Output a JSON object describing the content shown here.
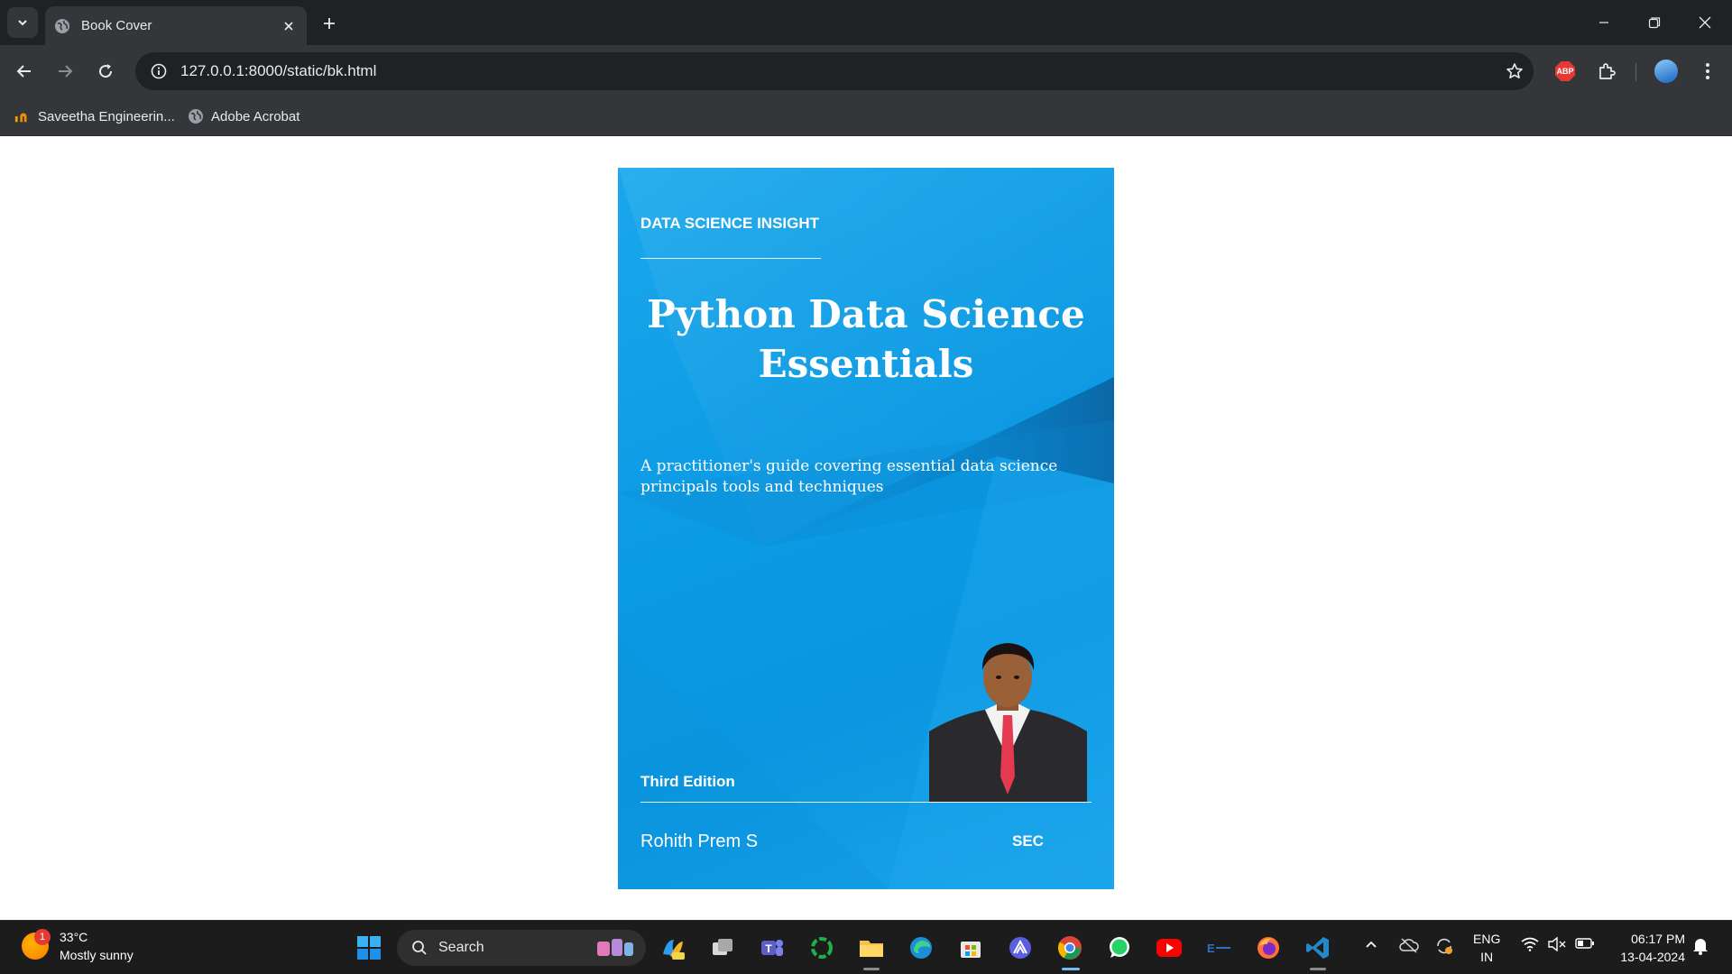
{
  "browser": {
    "tab_title": "Book Cover",
    "url": "127.0.0.1:8000/static/bk.html",
    "bookmarks": [
      {
        "label": "Saveetha Engineerin...",
        "icon": "saveetha-logo-icon"
      },
      {
        "label": "Adobe Acrobat",
        "icon": "globe-icon"
      }
    ],
    "extension_abp_label": "ABP"
  },
  "cover": {
    "series": "DATA SCIENCE INSIGHT",
    "title_line1": "Python Data Science",
    "title_line2": "Essentials",
    "subtitle": "A practitioner's guide covering essential data science principals tools and techniques",
    "edition": "Third Edition",
    "author": "Rohith Prem S",
    "publisher": "SEC",
    "colors": {
      "cover_blue": "#0b9ae4",
      "text": "#ffffff"
    }
  },
  "taskbar": {
    "weather_temp": "33°C",
    "weather_desc": "Mostly sunny",
    "weather_badge": "1",
    "search_placeholder": "Search",
    "lang_line1": "ENG",
    "lang_line2": "IN",
    "time": "06:17 PM",
    "date": "13-04-2024"
  }
}
